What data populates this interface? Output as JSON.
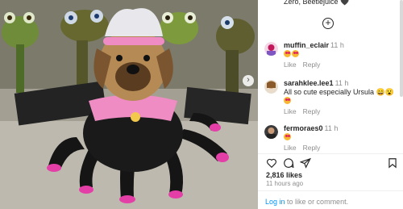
{
  "post": {
    "caption_tail": "Zero, Beetlejuice 🖤",
    "likes": "2,816 likes",
    "time": "11 hours ago"
  },
  "comments": [
    {
      "username": "muffin_eclair",
      "time": "11 h",
      "text": "",
      "emojis": [
        "heart-eyes",
        "heart-eyes"
      ],
      "like": "Like",
      "reply": "Reply"
    },
    {
      "username": "sarahklee.lee1",
      "time": "11 h",
      "text": "All so cute especially Ursula 😄😮",
      "emojis": [
        "heart-eyes"
      ],
      "like": "Like",
      "reply": "Reply"
    },
    {
      "username": "fermoraes0",
      "time": "11 h",
      "text": "",
      "emojis": [
        "heart-eyes"
      ],
      "like": "Like",
      "reply": "Reply"
    }
  ],
  "login": {
    "link": "Log in",
    "rest": "to like or comment."
  },
  "icons": {
    "next": "chevron-right-icon",
    "add_comment": "plus-circle-icon",
    "like": "heart-icon",
    "comment": "speech-bubble-icon",
    "share": "paper-plane-icon",
    "save": "bookmark-icon"
  },
  "colors": {
    "link": "#0095f6",
    "muted": "#8e8e8e",
    "costume_pink": "#f08cc4"
  }
}
